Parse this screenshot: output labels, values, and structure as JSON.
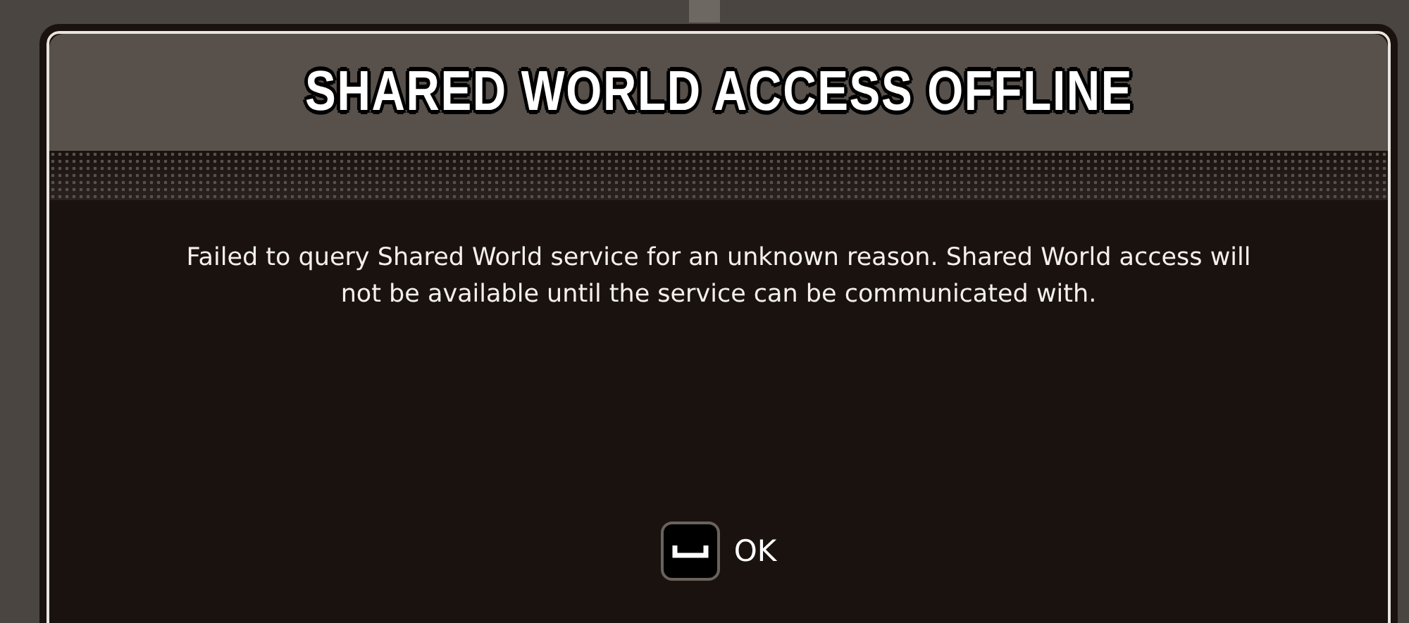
{
  "dialog": {
    "title": "SHARED WORLD ACCESS OFFLINE",
    "message": "Failed to query Shared World service for an unknown reason. Shared World access will not be available until the service can be communicated with.",
    "buttons": [
      {
        "label": "OK",
        "kind": "space-key"
      }
    ]
  }
}
